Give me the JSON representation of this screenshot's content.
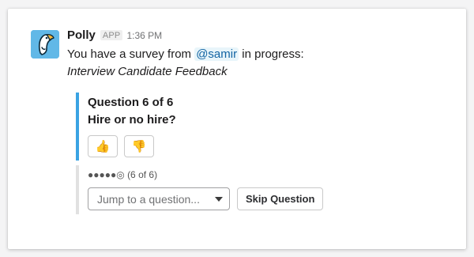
{
  "message": {
    "bot_name": "Polly",
    "app_badge": "APP",
    "timestamp": "1:36 PM",
    "avatar_icon": "polly-parrot-logo",
    "text_before": "You have a survey from ",
    "mention": "@samir",
    "text_after": " in progress:",
    "survey_title": "Interview Candidate Feedback"
  },
  "question": {
    "number_label": "Question 6 of 6",
    "text": "Hire or no hire?",
    "accent_color": "#3aa3e3",
    "buttons": [
      {
        "icon": "thumbs-up-icon",
        "glyph": "👍"
      },
      {
        "icon": "thumbs-down-icon",
        "glyph": "👎"
      }
    ]
  },
  "navigation": {
    "progress_dots": "●●●●●◎",
    "progress_label": "(6 of 6)",
    "jump_placeholder": "Jump to a question...",
    "skip_label": "Skip Question"
  }
}
